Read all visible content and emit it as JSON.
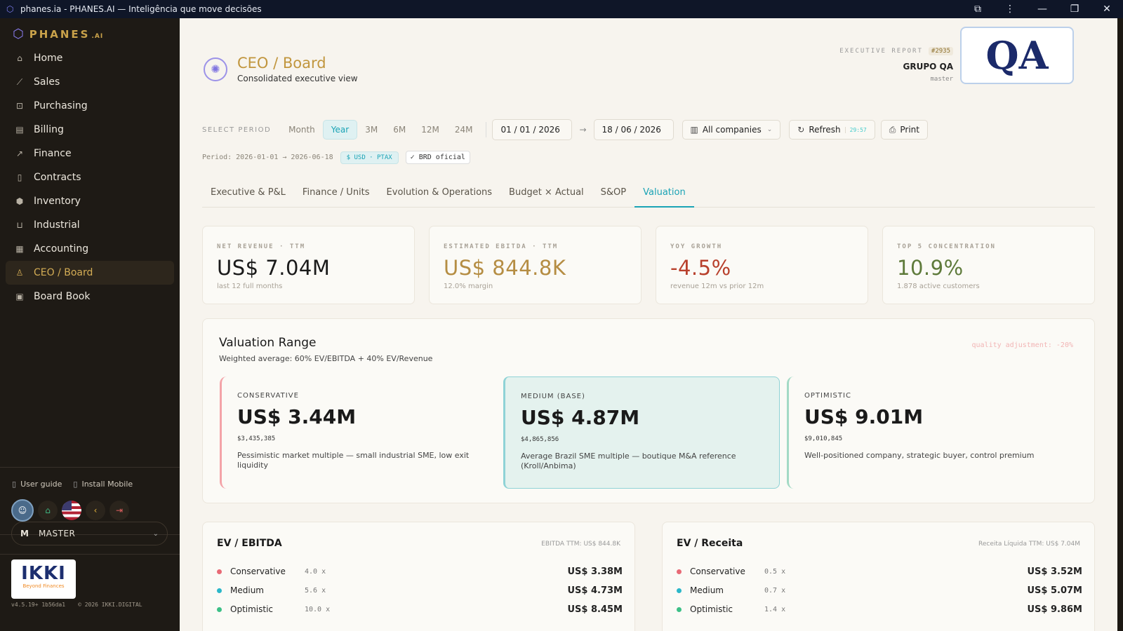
{
  "window": {
    "title": "phanes.ia - PHANES.AI — Inteligência que move decisões"
  },
  "sidebar": {
    "brand": "PHANES",
    "brand_suffix": ".AI",
    "items": [
      {
        "label": "Home",
        "icon": "home-icon"
      },
      {
        "label": "Sales",
        "icon": "chart-line-icon"
      },
      {
        "label": "Purchasing",
        "icon": "cart-icon"
      },
      {
        "label": "Billing",
        "icon": "receipt-icon"
      },
      {
        "label": "Finance",
        "icon": "trending-up-icon"
      },
      {
        "label": "Contracts",
        "icon": "document-icon"
      },
      {
        "label": "Inventory",
        "icon": "box-icon"
      },
      {
        "label": "Industrial",
        "icon": "factory-icon"
      },
      {
        "label": "Accounting",
        "icon": "ledger-icon"
      },
      {
        "label": "CEO / Board",
        "icon": "user-icon",
        "active": true
      },
      {
        "label": "Board Book",
        "icon": "book-icon"
      }
    ],
    "user_guide": "User guide",
    "install_mobile": "Install Mobile",
    "master_initial": "M",
    "master_label": "MASTER",
    "ikki_main": "IKKI",
    "ikki_tagline": "Beyond Finances",
    "version": "v4.5.19+ 1b56da1",
    "copyright": "© 2026 IKKI.DIGITAL"
  },
  "header": {
    "title": "CEO / Board",
    "subtitle": "Consolidated executive view",
    "exec_label": "EXECUTIVE REPORT",
    "report_number": "#2935",
    "company": "GRUPO QA",
    "user": "master",
    "client_logo": "QA"
  },
  "period": {
    "select_label": "SELECT PERIOD",
    "chips": [
      "Month",
      "Year",
      "3M",
      "6M",
      "12M",
      "24M"
    ],
    "active_chip": "Year",
    "date_from": "01 / 01 / 2026",
    "date_to": "18 / 06 / 2026",
    "companies": "All companies",
    "refresh": "Refresh",
    "refresh_timer": "29:57",
    "print": "Print",
    "period_text": "Period: 2026-01-01 → 2026-06-18",
    "currency_badge": "$ USD · PTAX",
    "brd_badge": "✓ BRD oficial"
  },
  "tabs": [
    "Executive & P&L",
    "Finance / Units",
    "Evolution & Operations",
    "Budget × Actual",
    "S&OP",
    "Valuation"
  ],
  "active_tab": "Valuation",
  "kpis": [
    {
      "label": "NET REVENUE · TTM",
      "value": "US$ 7.04M",
      "sub": "last 12 full months",
      "color": "#1a1a1a"
    },
    {
      "label": "ESTIMATED EBITDA · TTM",
      "value": "US$ 844.8K",
      "sub": "12.0% margin",
      "color": "#b58d43"
    },
    {
      "label": "YOY GROWTH",
      "value": "-4.5%",
      "sub": "revenue 12m vs prior 12m",
      "color": "#b8402c"
    },
    {
      "label": "TOP 5 CONCENTRATION",
      "value": "10.9%",
      "sub": "1.878 active customers",
      "color": "#5e7a3a"
    }
  ],
  "valuation": {
    "title": "Valuation Range",
    "subtitle": "Weighted average: 60% EV/EBITDA + 40% EV/Revenue",
    "quality": "quality adjustment: -20%",
    "scenarios": [
      {
        "label": "CONSERVATIVE",
        "value": "US$ 3.44M",
        "exact": "$3,435,385",
        "desc": "Pessimistic market multiple — small industrial SME, low exit liquidity"
      },
      {
        "label": "MEDIUM (BASE)",
        "value": "US$ 4.87M",
        "exact": "$4,865,856",
        "desc": "Average Brazil SME multiple — boutique M&A reference (Kroll/Anbima)"
      },
      {
        "label": "OPTIMISTIC",
        "value": "US$ 9.01M",
        "exact": "$9,010,845",
        "desc": "Well-positioned company, strategic buyer, control premium"
      }
    ]
  },
  "ev_ebitda": {
    "title": "EV / EBITDA",
    "ttm": "EBITDA TTM: US$ 844.8K",
    "rows": [
      {
        "name": "Conservative",
        "mult": "4.0 x",
        "amount": "US$ 3.38M",
        "color": "#e86a76"
      },
      {
        "name": "Medium",
        "mult": "5.6 x",
        "amount": "US$ 4.73M",
        "color": "#2bb7c9"
      },
      {
        "name": "Optimistic",
        "mult": "10.0 x",
        "amount": "US$ 8.45M",
        "color": "#3cc087"
      }
    ]
  },
  "ev_receita": {
    "title": "EV / Receita",
    "ttm": "Receita Líquida TTM: US$ 7.04M",
    "rows": [
      {
        "name": "Conservative",
        "mult": "0.5 x",
        "amount": "US$ 3.52M",
        "color": "#e86a76"
      },
      {
        "name": "Medium",
        "mult": "0.7 x",
        "amount": "US$ 5.07M",
        "color": "#2bb7c9"
      },
      {
        "name": "Optimistic",
        "mult": "1.4 x",
        "amount": "US$ 9.86M",
        "color": "#3cc087"
      }
    ]
  }
}
